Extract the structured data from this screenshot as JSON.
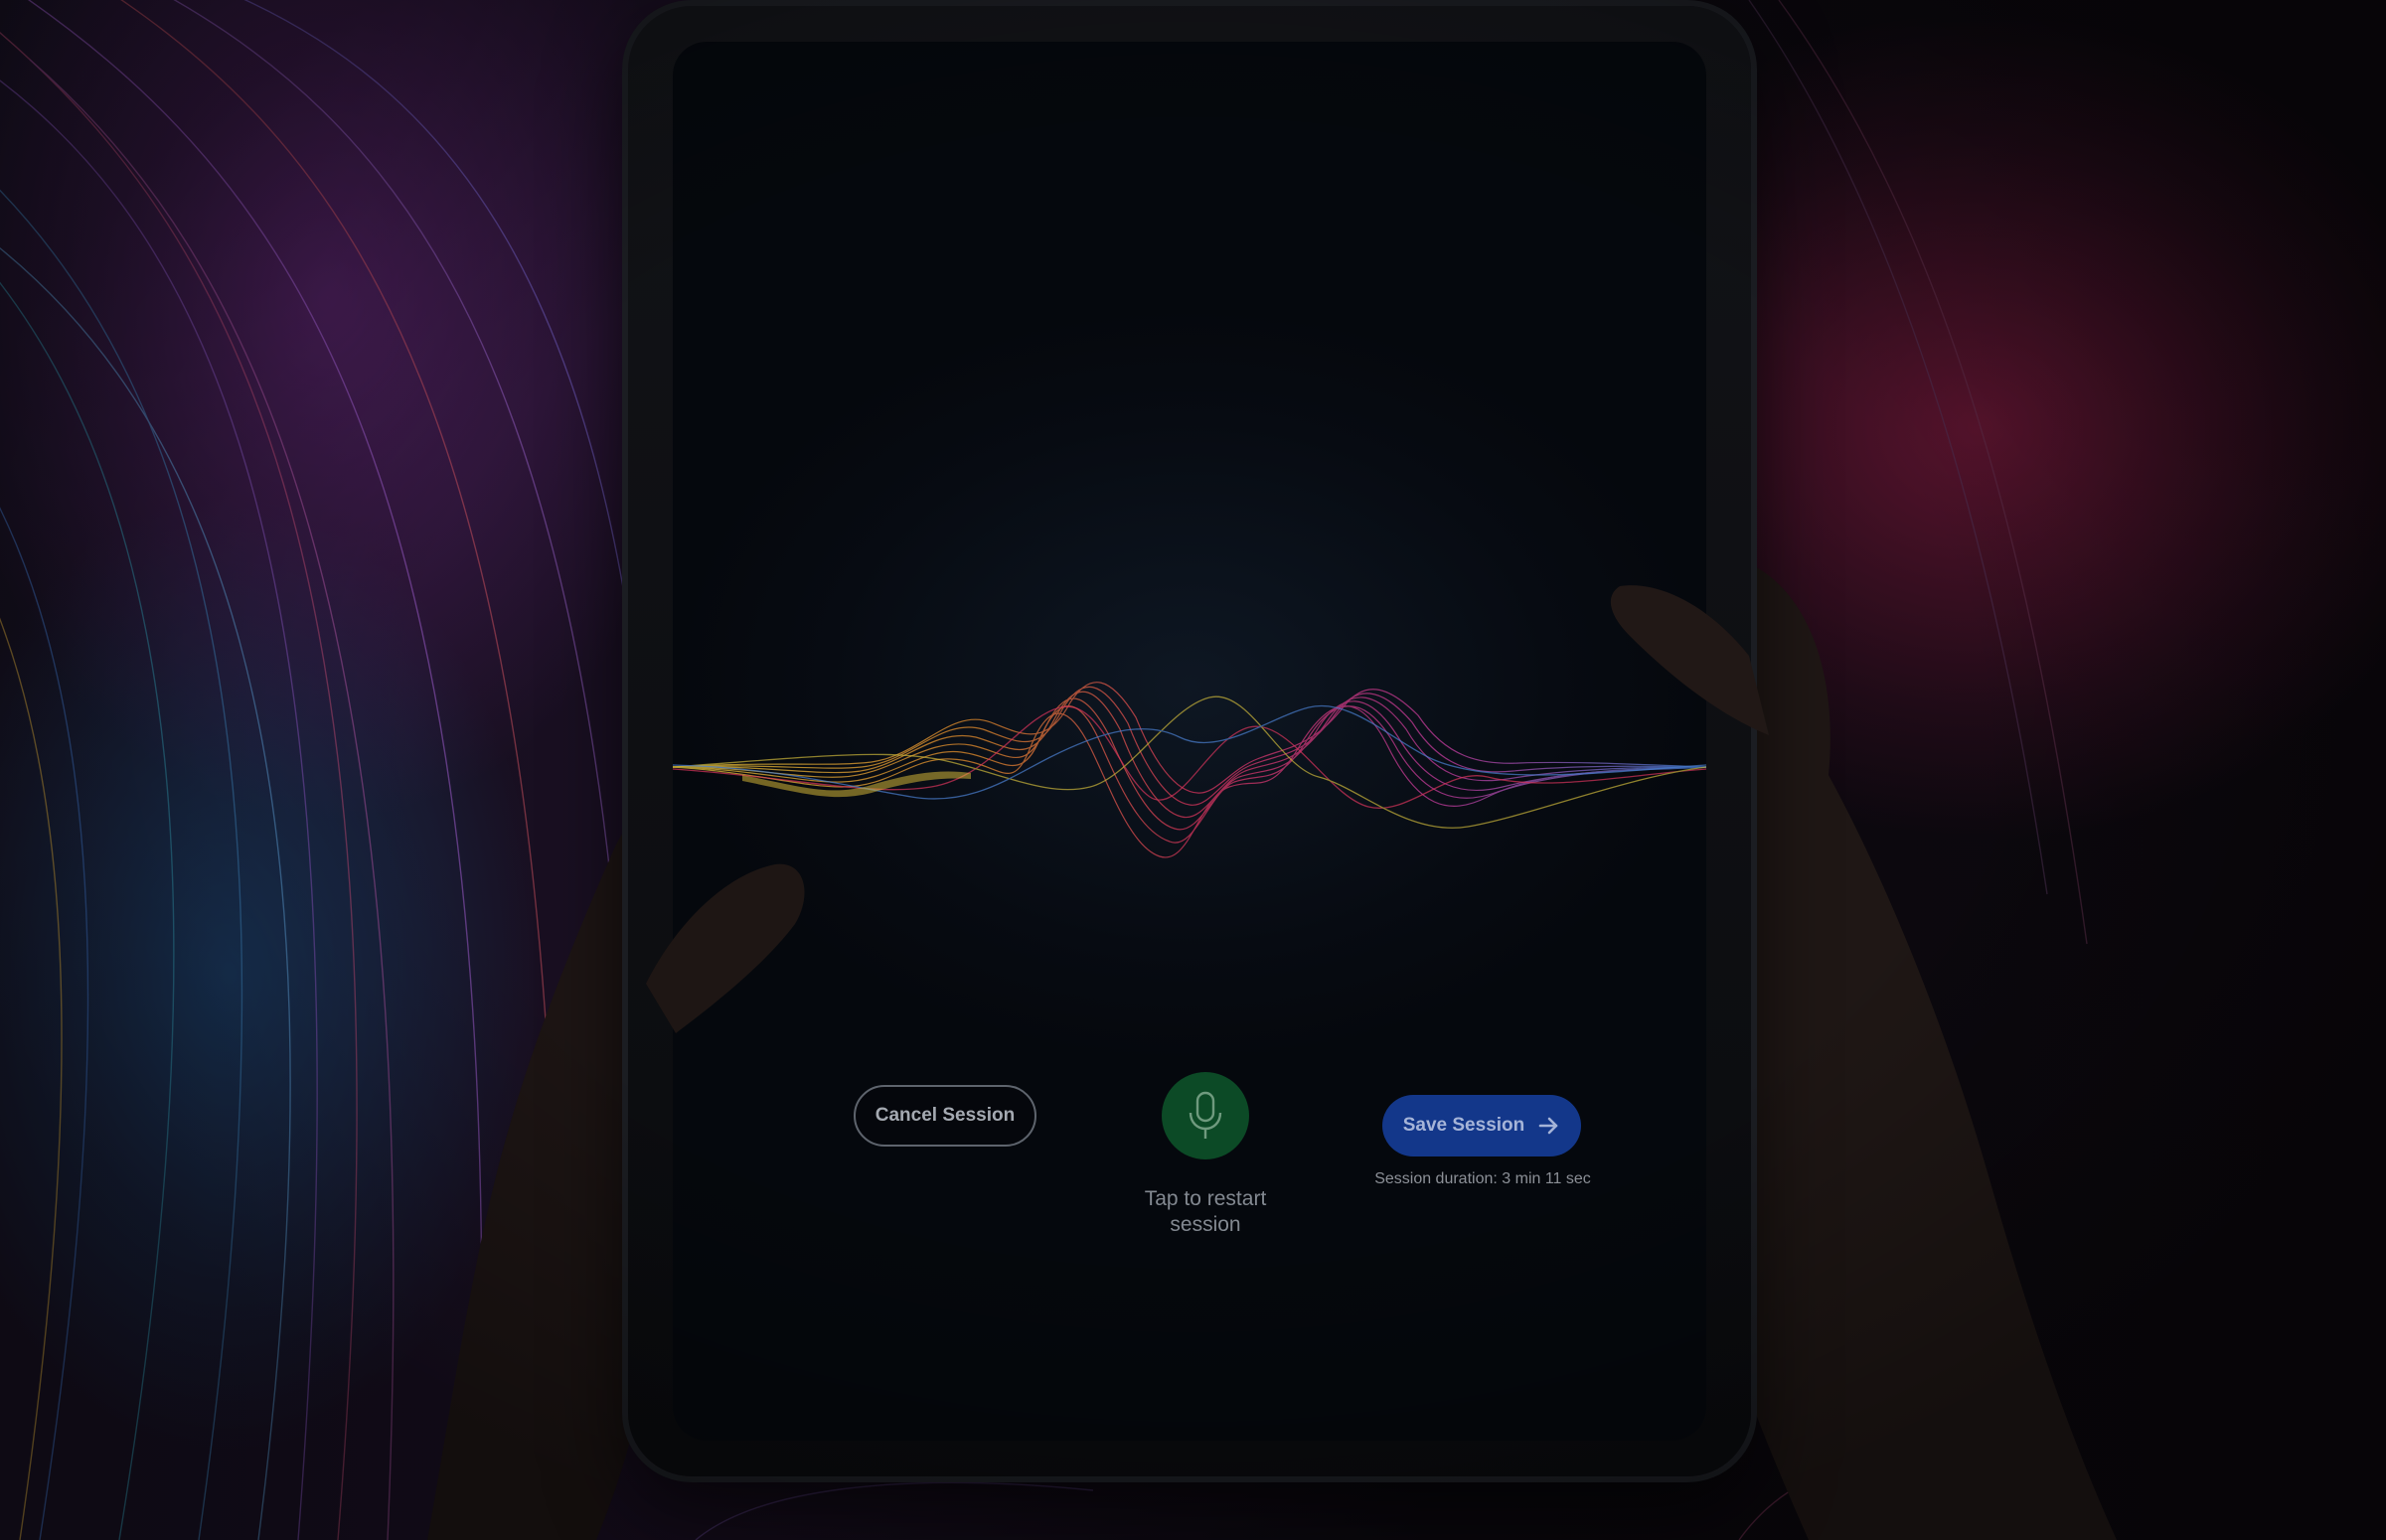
{
  "session": {
    "cancel_label": "Cancel Session",
    "mic_label": "Tap to restart\nsession",
    "save_label": "Save Session",
    "duration_text": "Session duration: 3 min 11 sec"
  },
  "icons": {
    "mic": "microphone-icon",
    "arrow": "arrow-right-icon"
  },
  "colors": {
    "mic_button": "#0c4a26",
    "save_button": "#13378a",
    "cancel_border": "#5e646d",
    "screen_bg": "#070b12"
  }
}
